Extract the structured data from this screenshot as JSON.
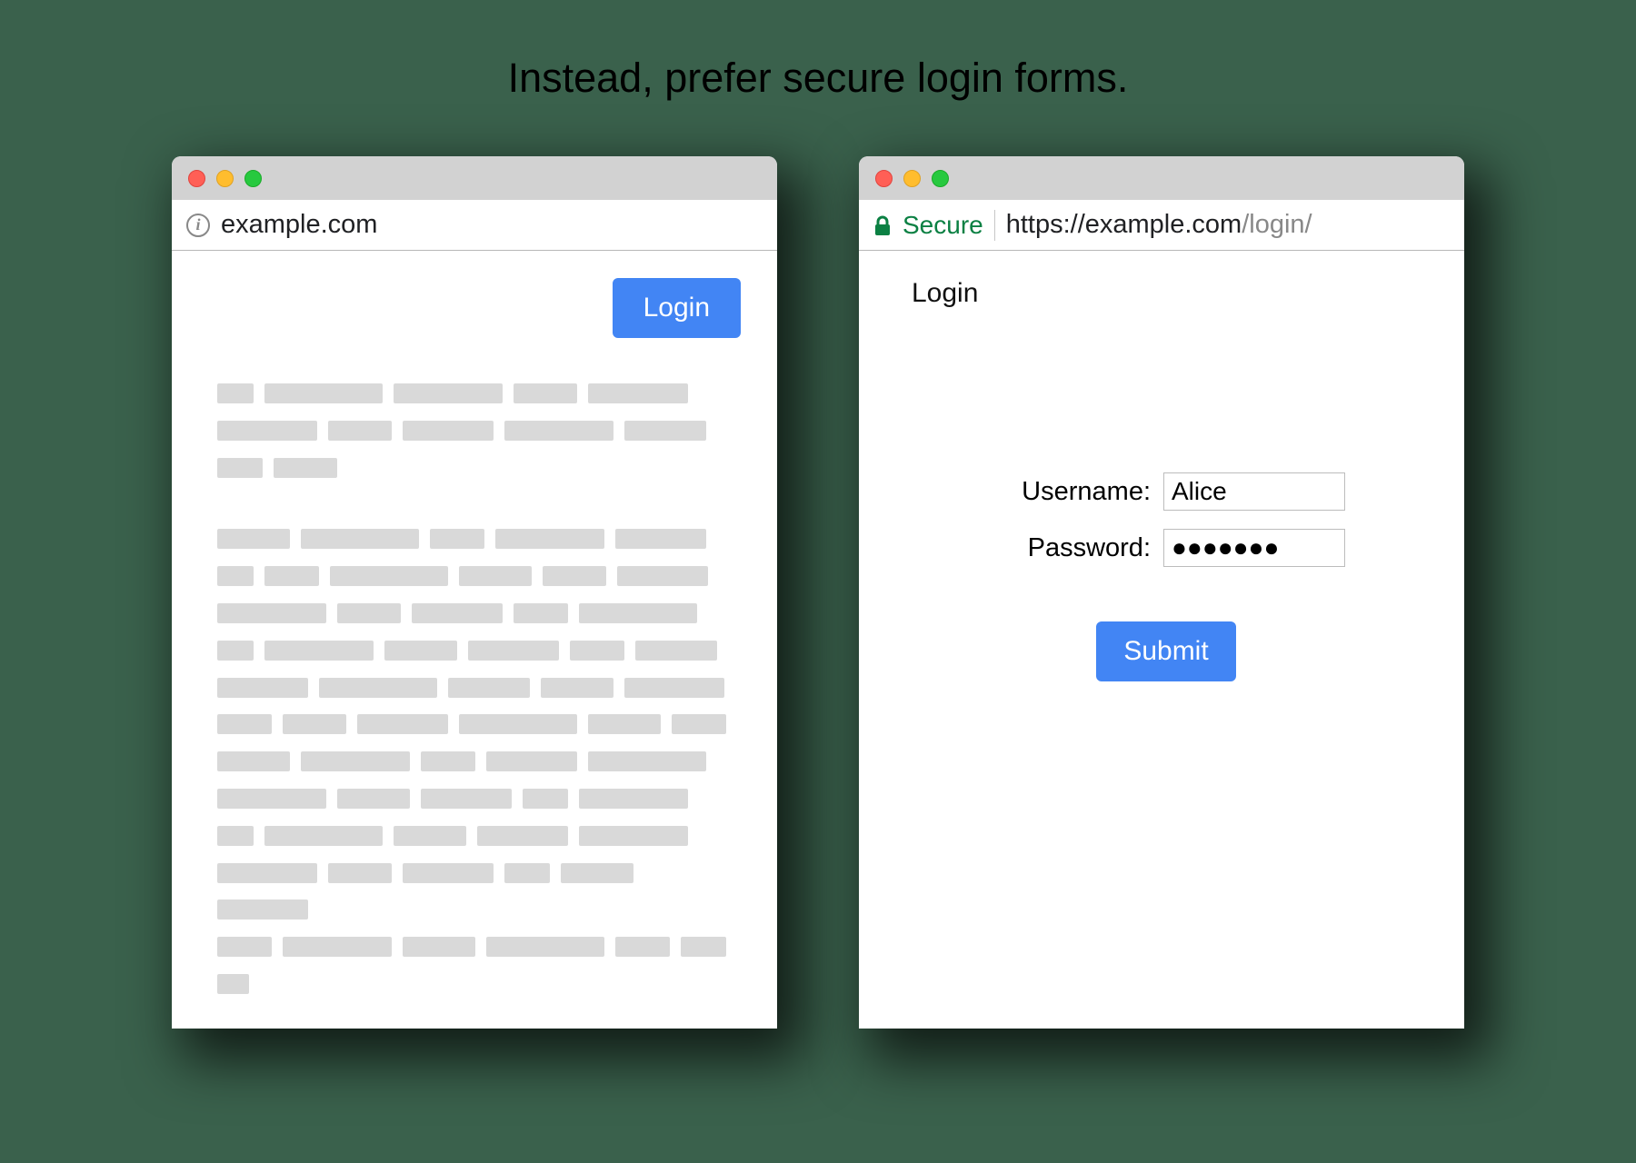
{
  "heading": "Instead, prefer secure login forms.",
  "left_window": {
    "address_url": "example.com",
    "login_button": "Login"
  },
  "right_window": {
    "secure_label": "Secure",
    "url_scheme_host": "https://example.com",
    "url_path": "/login/",
    "login_title": "Login",
    "username_label": "Username:",
    "username_value": "Alice",
    "password_label": "Password:",
    "password_value": "●●●●●●●",
    "submit_label": "Submit"
  },
  "colors": {
    "background": "#3a614c",
    "button_blue": "#4285f4",
    "secure_green": "#0b8043"
  }
}
